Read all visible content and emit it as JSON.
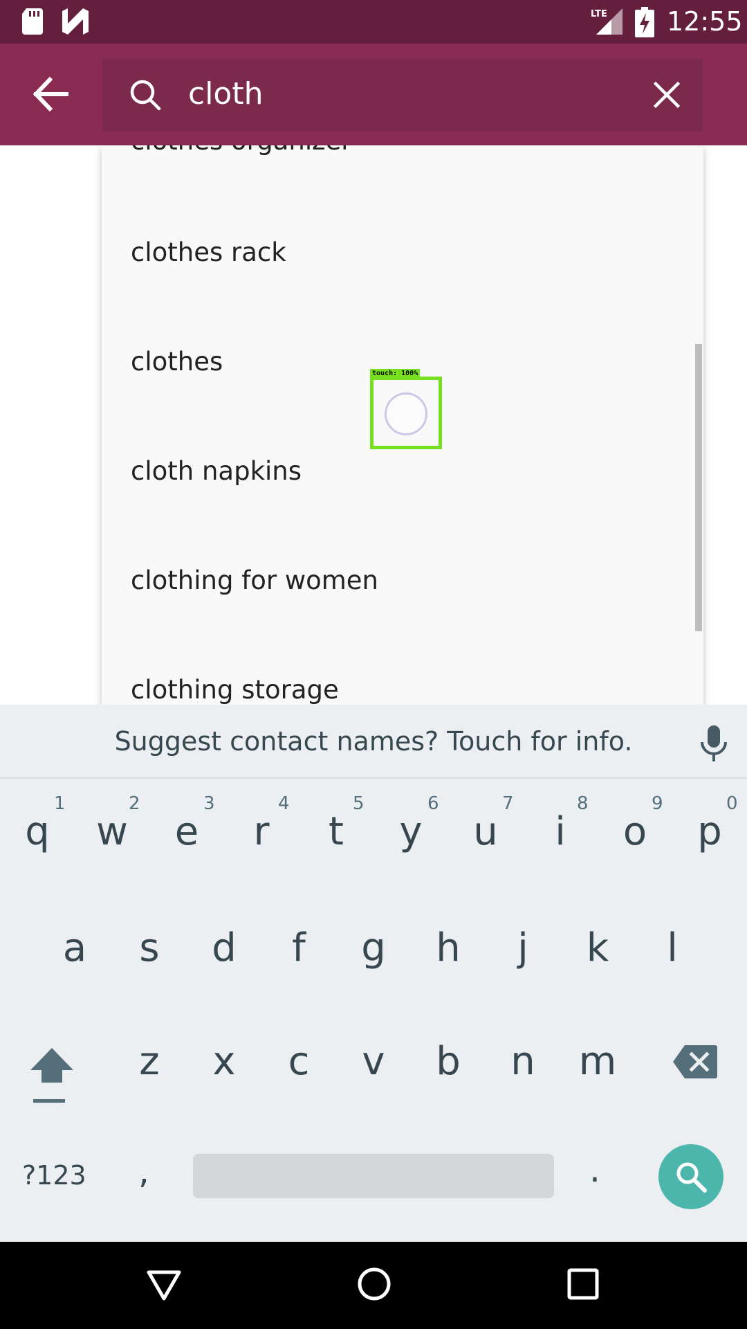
{
  "status_bar": {
    "time": "12:55",
    "network": "LTE",
    "icons": [
      "sd-card-icon",
      "n-notification-icon",
      "lte-signal-icon",
      "battery-charging-icon"
    ]
  },
  "toolbar": {
    "query": "cloth",
    "icons": [
      "back-arrow-icon",
      "search-icon",
      "clear-icon"
    ],
    "background": "#8a2c52"
  },
  "suggestions": {
    "items": [
      "clothes organizer",
      "clothes rack",
      "clothes",
      "cloth napkins",
      "clothing for women",
      "clothing storage"
    ]
  },
  "touch_indicator": {
    "label": "touch: 100%"
  },
  "keyboard": {
    "suggestion_strip": "Suggest contact names? Touch for info.",
    "row1": [
      "q",
      "w",
      "e",
      "r",
      "t",
      "y",
      "u",
      "i",
      "o",
      "p"
    ],
    "row1_hints": [
      "1",
      "2",
      "3",
      "4",
      "5",
      "6",
      "7",
      "8",
      "9",
      "0"
    ],
    "row2": [
      "a",
      "s",
      "d",
      "f",
      "g",
      "h",
      "j",
      "k",
      "l"
    ],
    "row3": [
      "z",
      "x",
      "c",
      "v",
      "b",
      "n",
      "m"
    ],
    "symbols_label": "?123",
    "comma": ",",
    "period": ".",
    "accent_color": "#4db6ac"
  },
  "nav_bar": {
    "icons": [
      "nav-back-icon",
      "nav-home-icon",
      "nav-recents-icon"
    ]
  }
}
